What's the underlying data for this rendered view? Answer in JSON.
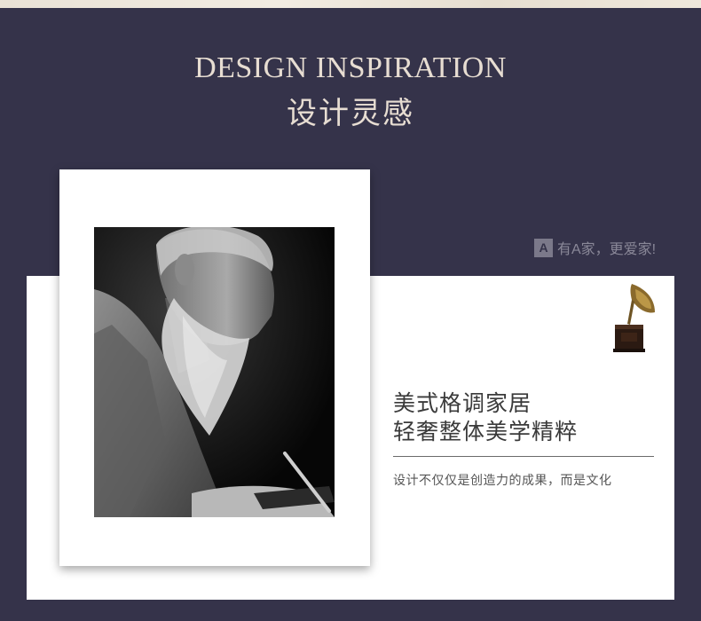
{
  "header": {
    "title_en": "DESIGN INSPIRATION",
    "title_cn": "设计灵感"
  },
  "watermark": {
    "logo_letter": "A",
    "text": "有A家，更爱家!"
  },
  "feature": {
    "tagline_line1": "美式格调家居",
    "tagline_line2": "轻奢整体美学精粹",
    "caption": "设计不仅仅是创造力的成果，而是文化"
  },
  "images": {
    "photo": "black-and-white portrait of elderly bearded artisan",
    "decor": "gramophone-icon"
  },
  "colors": {
    "background": "#35334a",
    "heading": "#e7ddd2",
    "panel": "#ffffff"
  }
}
